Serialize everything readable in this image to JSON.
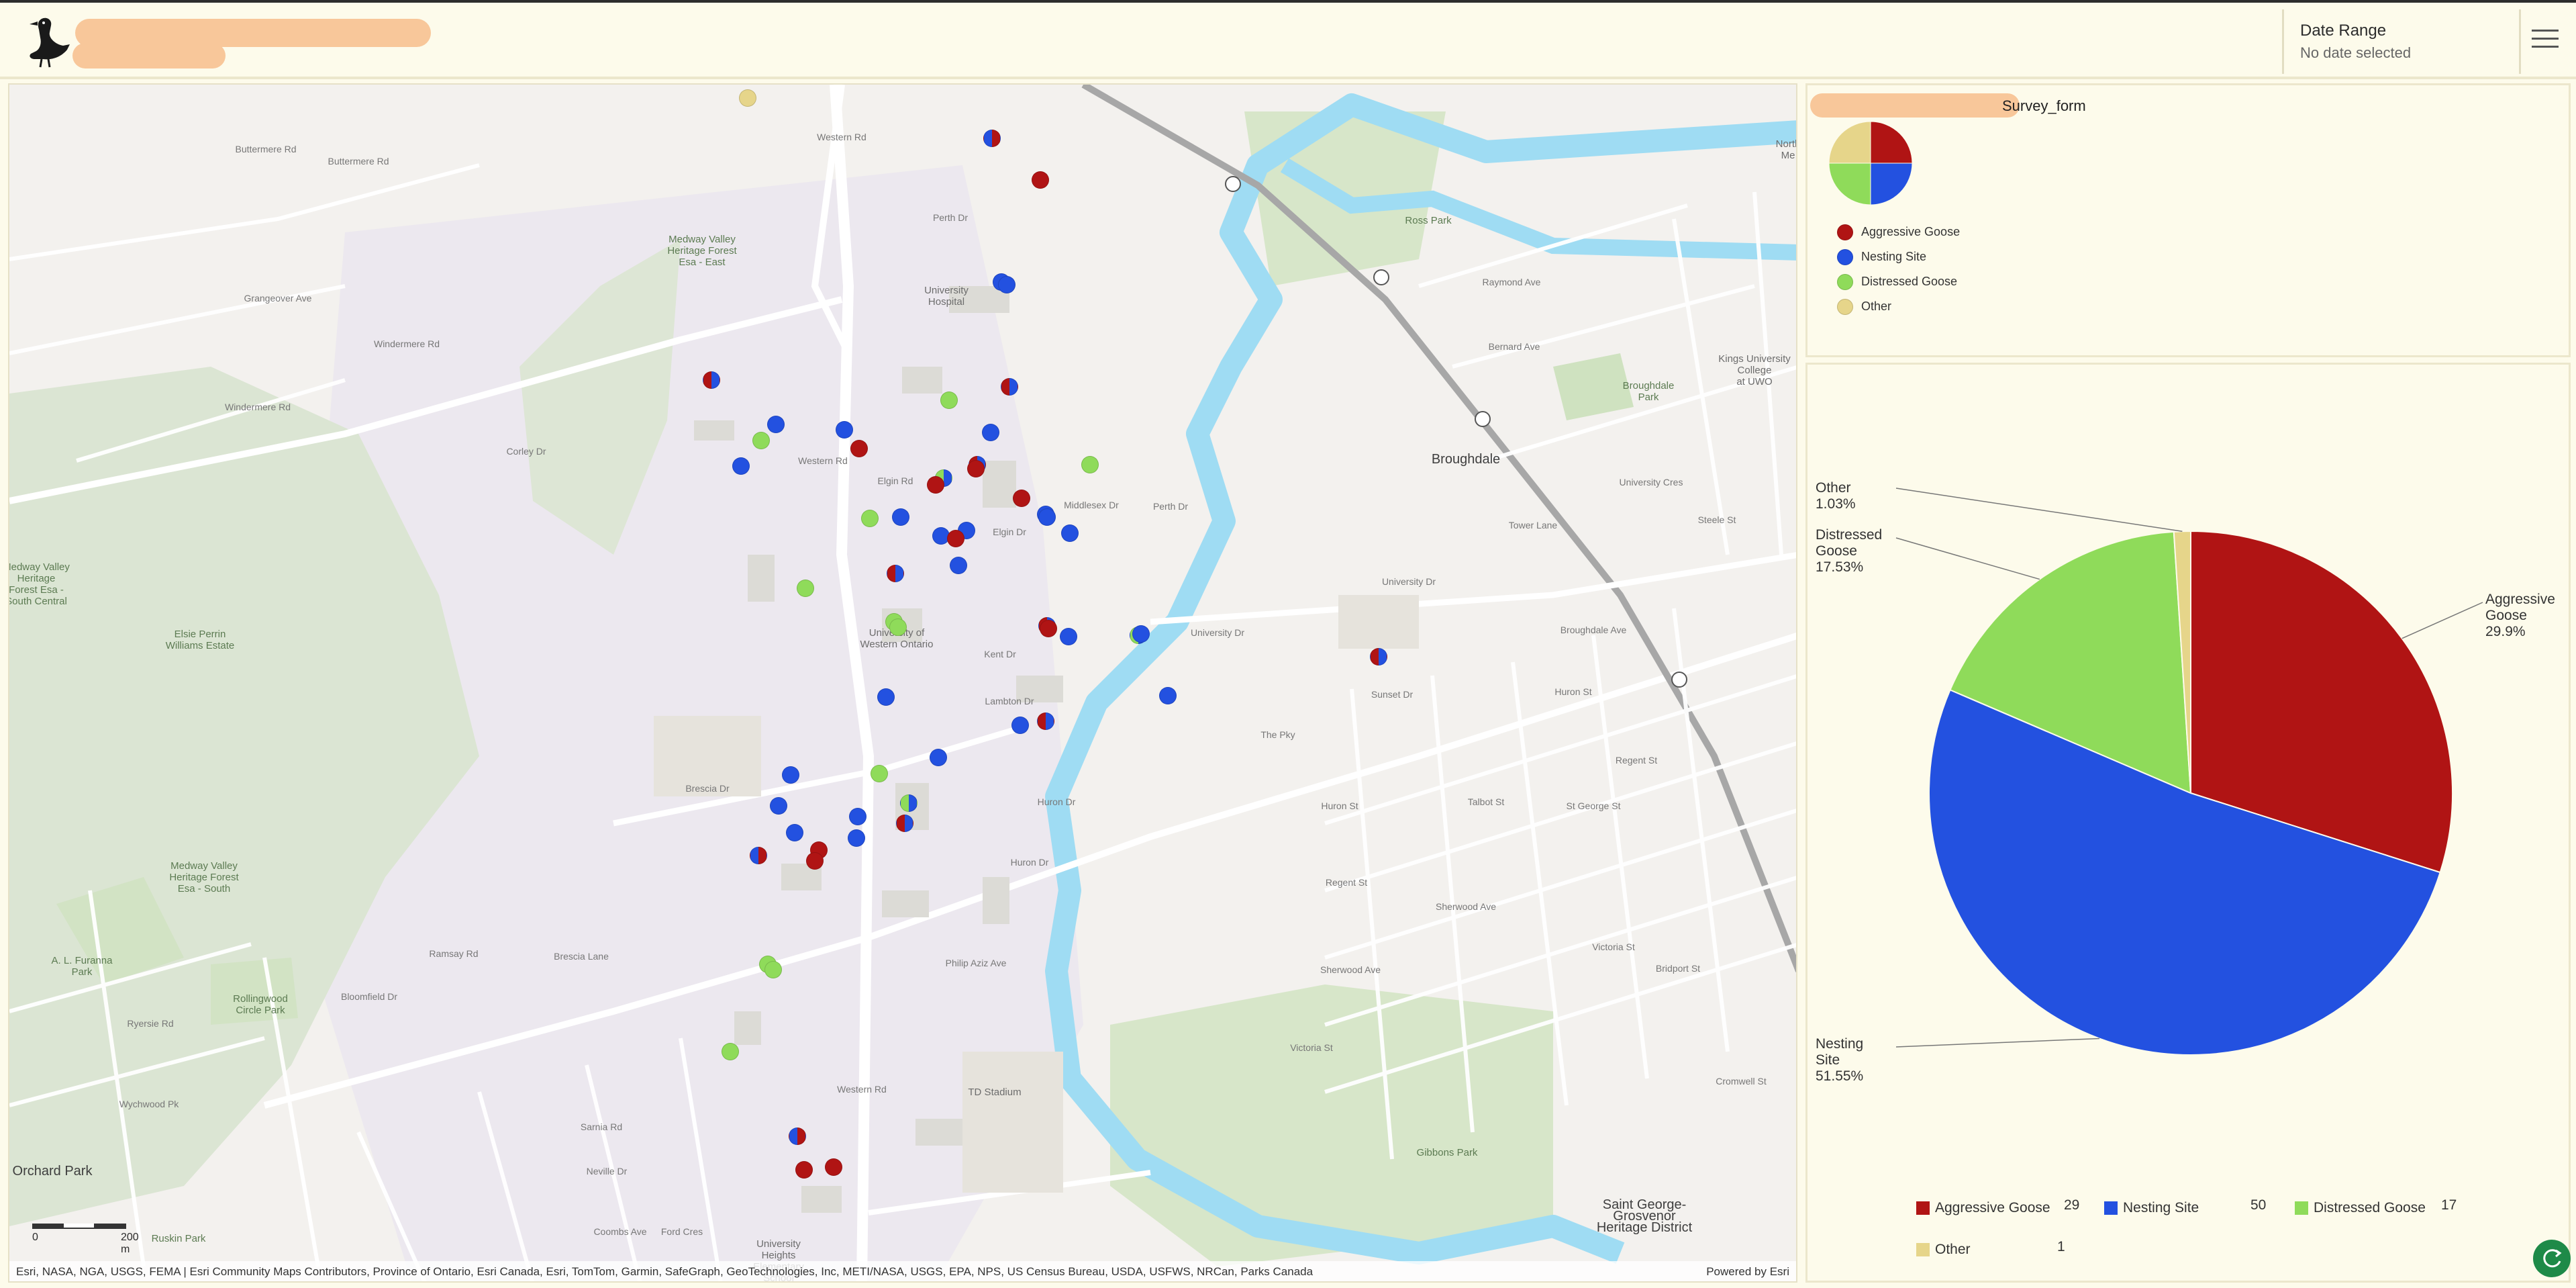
{
  "header": {
    "date_range_label": "Date Range",
    "date_range_value": "No date selected"
  },
  "map": {
    "labels": [
      {
        "text": "Medway Valley\nHeritage Forest\nEsa - East",
        "kind": "green"
      },
      {
        "text": "University\nHospital",
        "kind": ""
      },
      {
        "text": "Medway Valley\nHeritage\nForest Esa -\nSouth Central",
        "kind": "green"
      },
      {
        "text": "Elsie Perrin\nWilliams Estate",
        "kind": "green"
      },
      {
        "text": "University of\nWestern Ontario",
        "kind": ""
      },
      {
        "text": "Medway Valley\nHeritage Forest\nEsa - South",
        "kind": "green"
      },
      {
        "text": "A. L. Furanna\nPark",
        "kind": "green"
      },
      {
        "text": "Rollingwood\nCircle Park",
        "kind": "green"
      },
      {
        "text": "Orchard Park",
        "kind": "big"
      },
      {
        "text": "Ruskin Park",
        "kind": "green"
      },
      {
        "text": "University\nHeights\nElementary\nSchool",
        "kind": ""
      },
      {
        "text": "TD Stadium",
        "kind": ""
      },
      {
        "text": "Gibbons Park",
        "kind": "green"
      },
      {
        "text": "Saint George-\nGrosvenor\nHeritage District",
        "kind": "big"
      },
      {
        "text": "Broughdale",
        "kind": "big"
      },
      {
        "text": "Ross Park",
        "kind": "green"
      },
      {
        "text": "Broughdale\nPark",
        "kind": "green"
      },
      {
        "text": "Kings University\nCollege\nat UWO",
        "kind": ""
      },
      {
        "text": "North\nMe",
        "kind": ""
      },
      {
        "text": "Buttermere Rd",
        "kind": "road"
      },
      {
        "text": "Buttermere Rd",
        "kind": "road"
      },
      {
        "text": "Grangeover Ave",
        "kind": "road"
      },
      {
        "text": "Windermere Rd",
        "kind": "road"
      },
      {
        "text": "Windermere Rd",
        "kind": "road"
      },
      {
        "text": "Corley Dr",
        "kind": "road"
      },
      {
        "text": "Western Rd",
        "kind": "road"
      },
      {
        "text": "Western Rd",
        "kind": "road"
      },
      {
        "text": "Western Rd",
        "kind": "road"
      },
      {
        "text": "Elgin Rd",
        "kind": "road"
      },
      {
        "text": "Elgin Dr",
        "kind": "road"
      },
      {
        "text": "Middlesex Dr",
        "kind": "road"
      },
      {
        "text": "Perth Dr",
        "kind": "road"
      },
      {
        "text": "Perth Dr",
        "kind": "road"
      },
      {
        "text": "Lambton Dr",
        "kind": "road"
      },
      {
        "text": "Kent Dr",
        "kind": "road"
      },
      {
        "text": "Huron Dr",
        "kind": "road"
      },
      {
        "text": "Huron Dr",
        "kind": "road"
      },
      {
        "text": "Brescia Dr",
        "kind": "road"
      },
      {
        "text": "Brescia Lane",
        "kind": "road"
      },
      {
        "text": "Philip Aziz Ave",
        "kind": "road"
      },
      {
        "text": "Ramsay Rd",
        "kind": "road"
      },
      {
        "text": "Sarnia Rd",
        "kind": "road"
      },
      {
        "text": "University Dr",
        "kind": "road"
      },
      {
        "text": "University Dr",
        "kind": "road"
      },
      {
        "text": "University Cres",
        "kind": "road"
      },
      {
        "text": "Raymond Ave",
        "kind": "road"
      },
      {
        "text": "Bernard Ave",
        "kind": "road"
      },
      {
        "text": "Tower Lane",
        "kind": "road"
      },
      {
        "text": "Broughdale Ave",
        "kind": "road"
      },
      {
        "text": "Huron St",
        "kind": "road"
      },
      {
        "text": "Huron St",
        "kind": "road"
      },
      {
        "text": "Regent St",
        "kind": "road"
      },
      {
        "text": "Regent St",
        "kind": "road"
      },
      {
        "text": "Sherwood Ave",
        "kind": "road"
      },
      {
        "text": "Sherwood Ave",
        "kind": "road"
      },
      {
        "text": "Victoria St",
        "kind": "road"
      },
      {
        "text": "Victoria St",
        "kind": "road"
      },
      {
        "text": "Bridport St",
        "kind": "road"
      },
      {
        "text": "The Pky",
        "kind": "road"
      },
      {
        "text": "Sunset Dr",
        "kind": "road"
      },
      {
        "text": "St George St",
        "kind": "road"
      },
      {
        "text": "Steele St",
        "kind": "road"
      },
      {
        "text": "Talbot St",
        "kind": "road"
      },
      {
        "text": "Neville Dr",
        "kind": "road"
      },
      {
        "text": "Bloomfield Dr",
        "kind": "road"
      },
      {
        "text": "Ryersie Rd",
        "kind": "road"
      },
      {
        "text": "Wychwood Pk",
        "kind": "road"
      },
      {
        "text": "Coombs Ave",
        "kind": "road"
      },
      {
        "text": "Ford Cres",
        "kind": "road"
      },
      {
        "text": "Cromwell St",
        "kind": "road"
      }
    ],
    "scale_zero": "0",
    "scale_label": "200 m",
    "attribution": "Esri, NASA, NGA, USGS, FEMA | Esri Community Maps Contributors, Province of Ontario, Esri Canada, Esri, TomTom, Garmin, SafeGraph, GeoTechnologies, Inc, METI/NASA, USGS, EPA, NPS, US Census Bureau, USDA, USFWS, NRCan, Parks Canada",
    "powered_by": "Powered by Esri",
    "marker_colors": {
      "A": "#b01414",
      "N": "#2351e0",
      "D": "#8fdb5a",
      "O": "#e6d58a"
    }
  },
  "small_panel": {
    "title": "Survey_form",
    "legend": [
      {
        "label": "Aggressive Goose",
        "color": "#b01414"
      },
      {
        "label": "Nesting Site",
        "color": "#2351e0"
      },
      {
        "label": "Distressed Goose",
        "color": "#8fdb5a"
      },
      {
        "label": "Other",
        "color": "#e6d58a"
      }
    ]
  },
  "chart_data": {
    "type": "pie",
    "categories": [
      "Aggressive Goose",
      "Nesting Site",
      "Distressed Goose",
      "Other"
    ],
    "values": [
      29,
      50,
      17,
      1
    ],
    "percent_labels": [
      "29.9%",
      "51.55%",
      "17.53%",
      "1.03%"
    ],
    "colors": [
      "#b01414",
      "#2351e0",
      "#8fdb5a",
      "#e6d58a"
    ],
    "slice_labels": [
      {
        "name": "Aggressive\nGoose",
        "pct": "29.9%"
      },
      {
        "name": "Nesting\nSite",
        "pct": "51.55%"
      },
      {
        "name": "Distressed\nGoose",
        "pct": "17.53%"
      },
      {
        "name": "Other",
        "pct": "1.03%"
      }
    ],
    "legend": [
      {
        "label": "Aggressive Goose",
        "count": "29"
      },
      {
        "label": "Nesting Site",
        "count": "50"
      },
      {
        "label": "Distressed Goose",
        "count": "17"
      },
      {
        "label": "Other",
        "count": "1"
      }
    ]
  }
}
